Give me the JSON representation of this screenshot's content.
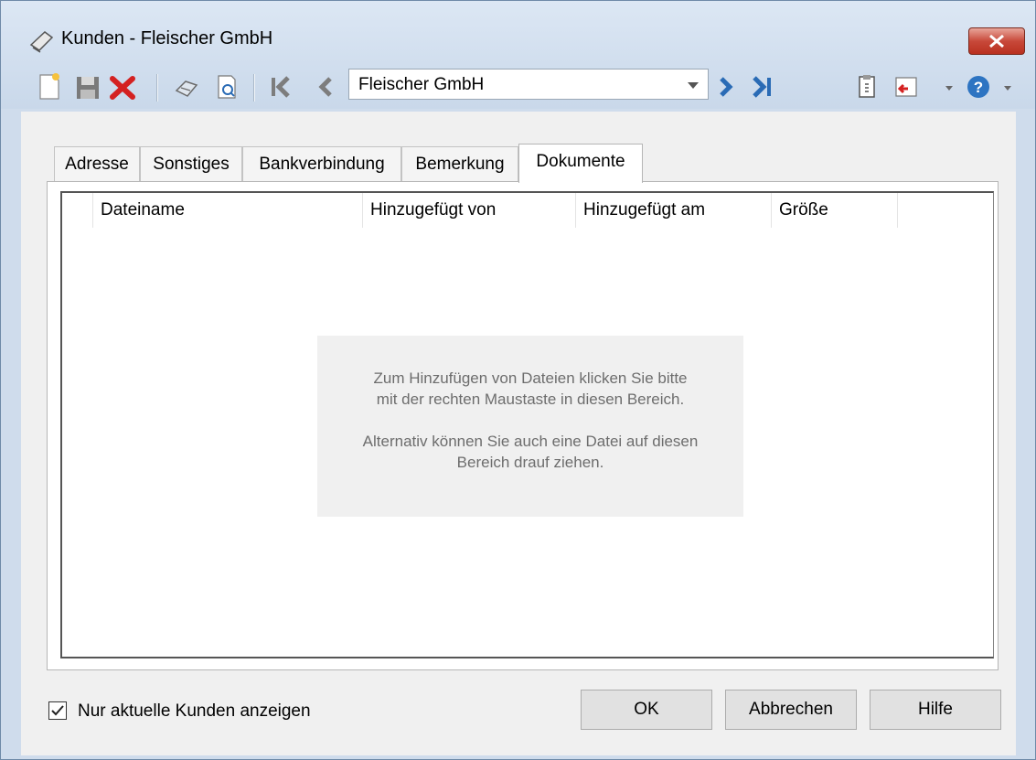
{
  "window": {
    "title": "Kunden - Fleischer GmbH",
    "close_glyph": "✕"
  },
  "toolbar": {
    "icons": [
      "new-document-icon",
      "save-icon",
      "delete-icon",
      "print-icon",
      "print-preview-icon",
      "first-record-icon",
      "previous-record-icon",
      "next-record-icon",
      "last-record-icon",
      "clipboard-icon",
      "exit-icon",
      "help-icon"
    ],
    "record_combo_value": "Fleischer GmbH"
  },
  "tabs": [
    "Adresse",
    "Sonstiges",
    "Bankverbindung",
    "Bemerkung",
    "Dokumente"
  ],
  "active_tab": "Dokumente",
  "documents": {
    "columns": [
      "Dateiname",
      "Hinzugefügt von",
      "Hinzugefügt am",
      "Größe"
    ],
    "rows": [],
    "hint_line1": "Zum Hinzufügen von Dateien klicken Sie bitte",
    "hint_line2": "mit der rechten Maustaste in diesen Bereich.",
    "hint_line3": "Alternativ können Sie auch eine Datei auf diesen",
    "hint_line4": "Bereich drauf ziehen."
  },
  "footer": {
    "checkbox_label": "Nur aktuelle Kunden anzeigen",
    "checkbox_checked": true,
    "ok_label": "OK",
    "cancel_label": "Abbrechen",
    "help_label": "Hilfe"
  },
  "colors": {
    "titlebar": "#d3e0ef",
    "close_button": "#c8493a",
    "delete_icon": "#d42121",
    "navigation_icon": "#2a6bb5"
  }
}
